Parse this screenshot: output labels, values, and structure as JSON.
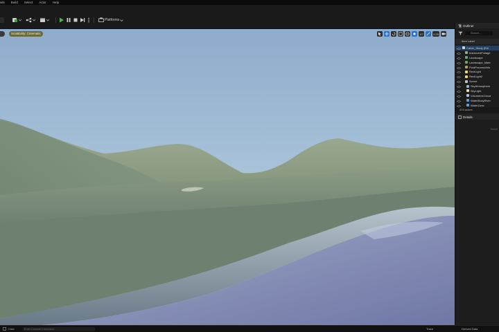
{
  "menu": [
    "ails",
    "Build",
    "Select",
    "Actor",
    "Help"
  ],
  "toolbar": {
    "platforms_label": "Platforms"
  },
  "viewport": {
    "scalability_badge": "Scalability: Cinematic",
    "tools": [
      "",
      "",
      "",
      "",
      "",
      "",
      "10°",
      "",
      "0.25",
      ""
    ]
  },
  "outliner": {
    "tab_label": "Outliner",
    "search_placeholder": "Search...",
    "column_header": "Item Label",
    "items": [
      {
        "label": "Calvin_Study (Edi",
        "selected": true
      },
      {
        "label": "InstancedFoliage"
      },
      {
        "label": "Landscape"
      },
      {
        "label": "Landscape_Mate"
      },
      {
        "label": "PostProcessVolu"
      },
      {
        "label": "RectLight"
      },
      {
        "label": "RectLight2"
      },
      {
        "label": "Scene"
      },
      {
        "label": "SkyAtmosphere"
      },
      {
        "label": "SkyLight"
      },
      {
        "label": "VolumetricCloud"
      },
      {
        "label": "WaterBodyRiver"
      },
      {
        "label": "WaterZone"
      }
    ],
    "actor_count": "473 actors"
  },
  "details": {
    "tab_label": "Details",
    "empty_text": "Select"
  },
  "statusbar": {
    "cmd_label": "Cmd",
    "console_placeholder": "Enter Console Command",
    "trace_label": "Trace",
    "derived_data_label": "Derived Data"
  }
}
